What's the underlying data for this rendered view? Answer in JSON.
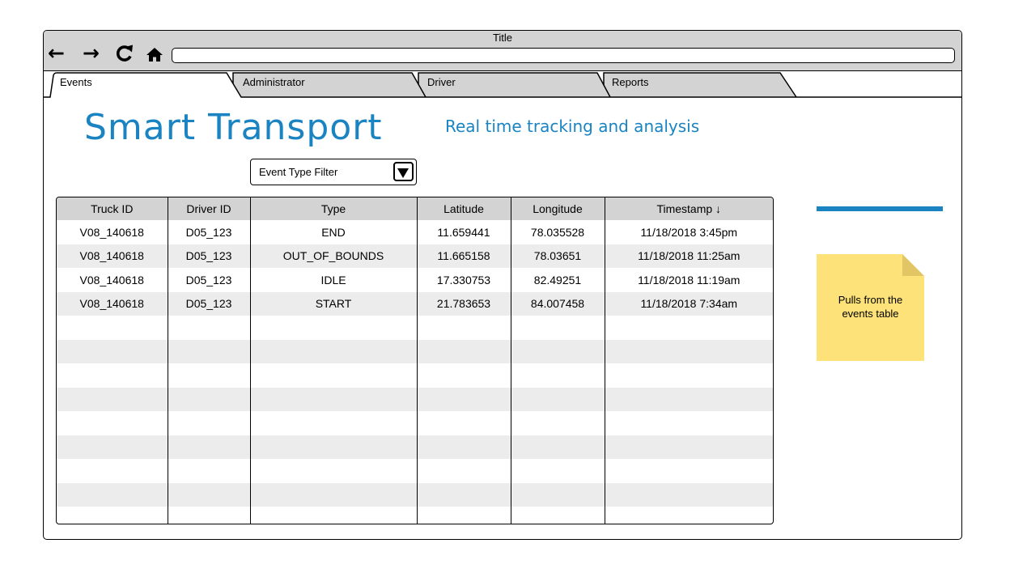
{
  "window": {
    "title": "Title",
    "url": ""
  },
  "nav": {
    "back_icon": "arrow-left-icon",
    "forward_icon": "arrow-right-icon",
    "reload_icon": "reload-icon",
    "home_icon": "home-icon"
  },
  "tabs": [
    {
      "label": "Events",
      "active": true
    },
    {
      "label": "Administrator",
      "active": false
    },
    {
      "label": "Driver",
      "active": false
    },
    {
      "label": "Reports",
      "active": false
    }
  ],
  "header": {
    "logo": "Smart Transport",
    "subtitle": "Real time tracking and analysis"
  },
  "filter": {
    "label": "Event Type Filter"
  },
  "table": {
    "columns": [
      "Truck ID",
      "Driver ID",
      "Type",
      "Latitude",
      "Longitude",
      "Timestamp ↓"
    ],
    "rows": [
      [
        "V08_140618",
        "D05_123",
        "END",
        "11.659441",
        "78.035528",
        "11/18/2018 3:45pm"
      ],
      [
        "V08_140618",
        "D05_123",
        "OUT_OF_BOUNDS",
        "11.665158",
        "78.03651",
        "11/18/2018 11:25am"
      ],
      [
        "V08_140618",
        "D05_123",
        "IDLE",
        "17.330753",
        "82.49251",
        "11/18/2018 11:19am"
      ],
      [
        "V08_140618",
        "D05_123",
        "START",
        "21.783653",
        "84.007458",
        "11/18/2018 7:34am"
      ]
    ],
    "empty_rows": 9
  },
  "note": {
    "line1": "Pulls from the",
    "line2": "events table"
  },
  "colors": {
    "accent": "#1a84c3",
    "titlebar": "#d3d3d3",
    "note_fill": "#fde27a",
    "note_fold": "#e2c665",
    "row_alt": "#ececec"
  }
}
